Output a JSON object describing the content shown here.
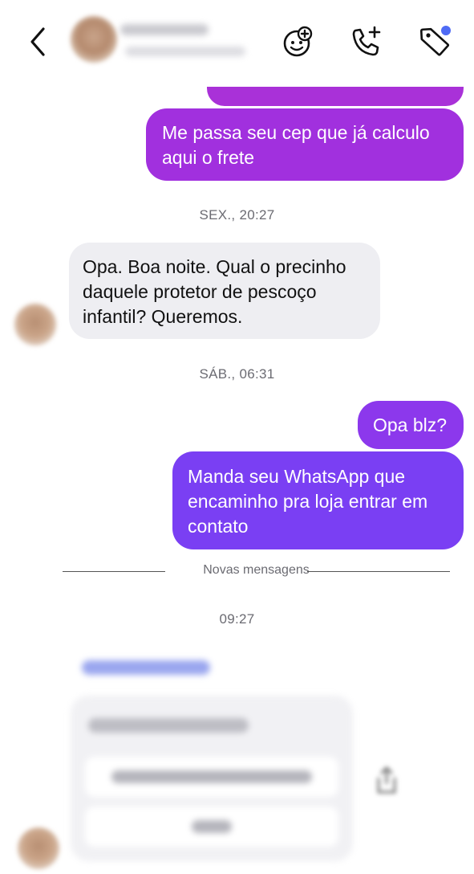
{
  "messages": [
    {
      "id": "m1",
      "direction": "outgoing",
      "text": "Me passa seu cep que já calculo aqui o frete"
    },
    {
      "id": "m2",
      "direction": "incoming",
      "text": "Opa. Boa noite. Qual o precinho daquele protetor de pescoço infantil? Queremos."
    },
    {
      "id": "m3",
      "direction": "outgoing",
      "text": "Opa blz?"
    },
    {
      "id": "m4",
      "direction": "outgoing",
      "text": "Manda seu WhatsApp que encaminho pra loja entrar em contato"
    }
  ],
  "timestamps": {
    "t1": "SEX., 20:27",
    "t2": "SÁB., 06:31",
    "t3": "09:27"
  },
  "divider_label": "Novas mensagens",
  "header": {
    "icons": [
      "back-chevron-icon",
      "sticker-icon",
      "add-call-icon",
      "tag-icon"
    ],
    "notification_dot_color": "#4f6bf5"
  },
  "colors": {
    "outgoing_purple_1": "#a42fd9",
    "outgoing_purple_2": "#7b3ff3",
    "incoming_gray": "#eeeef2"
  }
}
